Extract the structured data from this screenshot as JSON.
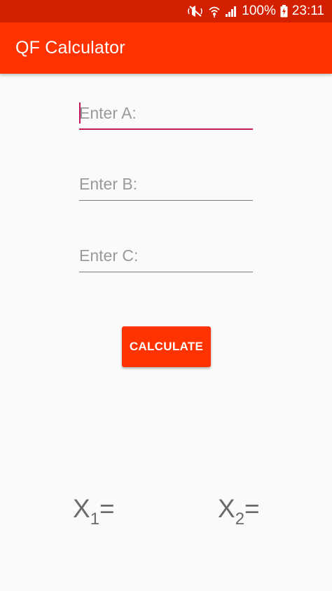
{
  "status_bar": {
    "battery": "100%",
    "time": "23:11",
    "icons": [
      "mute-icon",
      "wifi-icon",
      "signal-icon",
      "battery-charging-icon"
    ]
  },
  "app_bar": {
    "title": "QF Calculator",
    "color": "#ff3300"
  },
  "form": {
    "field_a": {
      "placeholder": "Enter A:",
      "value": "",
      "focused": true
    },
    "field_b": {
      "placeholder": "Enter B:",
      "value": ""
    },
    "field_c": {
      "placeholder": "Enter C:",
      "value": ""
    },
    "accent_color": "#c2185b"
  },
  "actions": {
    "calculate_label": "CALCULATE"
  },
  "results": {
    "x1": {
      "symbol": "X",
      "subscript": "1",
      "equals": "=",
      "value": ""
    },
    "x2": {
      "symbol": "X",
      "subscript": "2",
      "equals": "=",
      "value": ""
    }
  }
}
